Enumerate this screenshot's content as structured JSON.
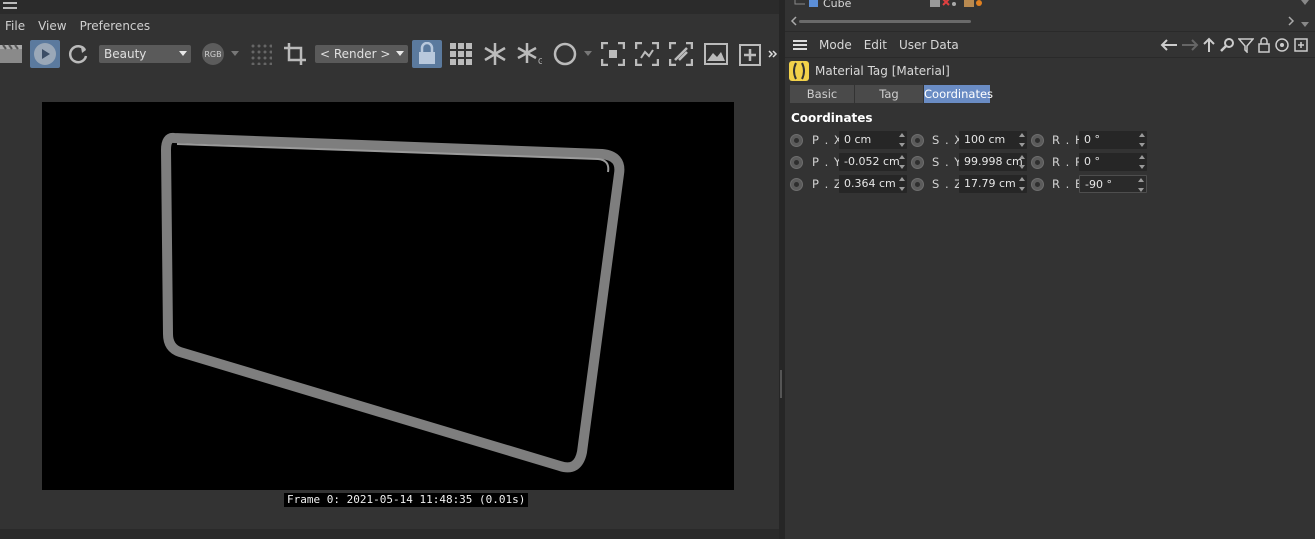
{
  "viewer": {
    "menu": [
      "File",
      "View",
      "Preferences"
    ],
    "toolbar": {
      "render_pass_dropdown": "Beauty",
      "rgb_button": "RGB",
      "region_dropdown": "< Render >"
    },
    "frame_info": "Frame 0: 2021-05-14 11:48:35 (0.01s)"
  },
  "attribute_manager": {
    "object_name": "Cube",
    "menu": [
      "Mode",
      "Edit",
      "User Data"
    ],
    "tag_title": "Material Tag [Material]",
    "tabs": [
      {
        "label": "Basic",
        "active": false
      },
      {
        "label": "Tag",
        "active": false
      },
      {
        "label": "Coordinates",
        "active": true
      }
    ],
    "section_title": "Coordinates",
    "rows": [
      {
        "p_label": "P . X",
        "p_value": "0 cm",
        "s_label": "S . X",
        "s_value": "100 cm",
        "r_label": "R . H",
        "r_value": "0 °"
      },
      {
        "p_label": "P . Y",
        "p_value": "-0.052 cm",
        "s_label": "S . Y",
        "s_value": "99.998 cm",
        "r_label": "R . P",
        "r_value": "0 °"
      },
      {
        "p_label": "P . Z",
        "p_value": "0.364 cm",
        "s_label": "S . Z",
        "s_value": "17.79 cm",
        "r_label": "R . B",
        "r_value": "-90 °"
      }
    ]
  },
  "colors": {
    "accent": "#6a8cc4",
    "active_button": "#5b7a9e",
    "panel_bg": "#333333",
    "render_bg": "#000000",
    "frame_stroke": "#8a8a8a"
  }
}
